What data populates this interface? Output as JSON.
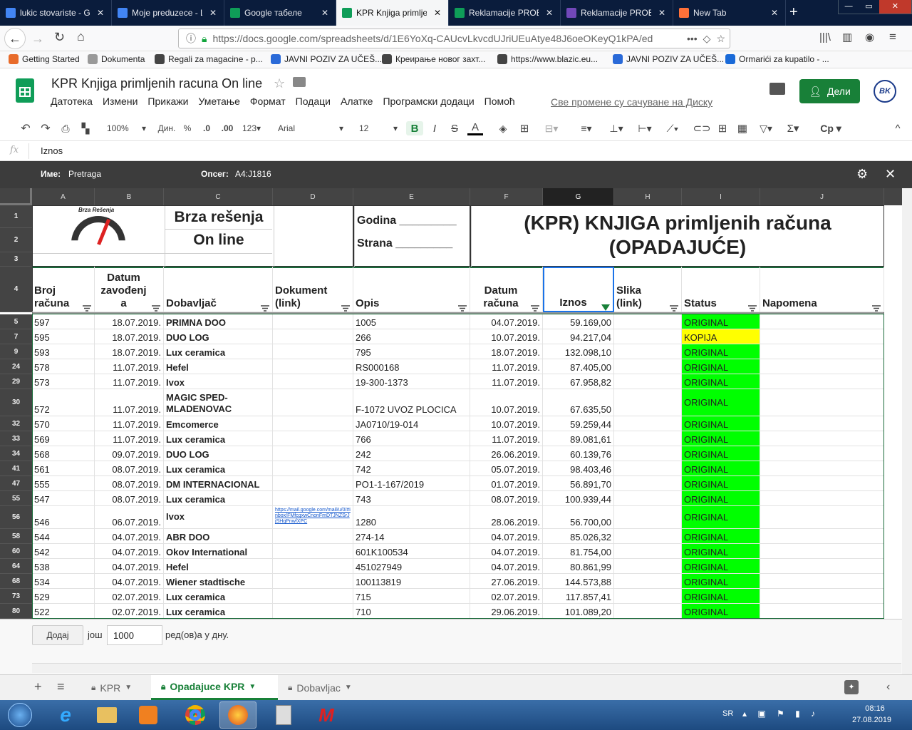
{
  "browser_tabs": [
    {
      "title": "lukic stovariste - G",
      "color": "#4285f4"
    },
    {
      "title": "Moje preduzece - L",
      "color": "#4285f4"
    },
    {
      "title": "Google табеле",
      "color": "#0f9d58"
    },
    {
      "title": "KPR Knjiga primlje",
      "color": "#0f9d58"
    },
    {
      "title": "Reklamacije PROB",
      "color": "#0f9d58"
    },
    {
      "title": "Reklamacije PROB",
      "color": "#7248b9"
    },
    {
      "title": "New Tab",
      "color": "#ff7139"
    }
  ],
  "url": "https://docs.google.com/spreadsheets/d/1E6YoXq-CAUcvLkvcdUJriUEuAtye48J6oeOKeyQ1kPA/ed",
  "bookmarks": [
    "Getting Started",
    "Dokumenta",
    "Regali za magacine - p...",
    "JAVNI POZIV ZA UČEŠ...",
    "Креирање новог захт...",
    "https://www.blazic.eu...",
    "JAVNI POZIV ZA UČEŠ...",
    "Ormarići za kupatilo - ..."
  ],
  "doc_title": "KPR Knjiga primljenih racuna On line",
  "menu": [
    "Датотека",
    "Измени",
    "Прикажи",
    "Уметање",
    "Формат",
    "Подаци",
    "Алатке",
    "Програмски додаци",
    "Помоћ"
  ],
  "save_status": "Све промене су сачуване на Диску",
  "share_label": "Дели",
  "toolbar": {
    "zoom": "100%",
    "currency": "Дин.",
    "percent": "%",
    "dec_less": ".0",
    "dec_more": ".00",
    "format": "123",
    "font": "Arial",
    "size": "12",
    "bold": "B",
    "italic": "I",
    "strike": "S",
    "textcolor": "A"
  },
  "formula": {
    "fx": "fx",
    "value": "Iznos"
  },
  "filter_view": {
    "name_label": "Име:",
    "name": "Pretraga",
    "range_label": "Опсег:",
    "range": "A4:J1816"
  },
  "columns": [
    "A",
    "B",
    "C",
    "D",
    "E",
    "F",
    "G",
    "H",
    "I",
    "J"
  ],
  "header_block": {
    "logo_text": "Brza Rešenja",
    "company_line1": "Brza rešenja",
    "company_line2": "On line",
    "godina": "Godina _________",
    "strana": "Strana _________",
    "title_line1": "(KPR) KNJIGA primljenih računa",
    "title_line2": "(OPADAJUĆE)"
  },
  "table_headers": [
    "Broj računa",
    "Datum zavođenj a",
    "Dobavljač",
    "Dokument (link)",
    "Opis",
    "Datum računa",
    "Iznos",
    "Slika (link)",
    "Status",
    "Napomena"
  ],
  "top_row_numbers": [
    "1",
    "2",
    "3",
    "4"
  ],
  "rows": [
    {
      "n": "5",
      "broj": "597",
      "datum": "18.07.2019.",
      "dob": "PRIMNA DOO",
      "dok": "",
      "opis": "1005",
      "dr": "04.07.2019.",
      "iznos": "59.169,00",
      "status": "ORIGINAL"
    },
    {
      "n": "7",
      "broj": "595",
      "datum": "18.07.2019.",
      "dob": "DUO LOG",
      "dok": "",
      "opis": "266",
      "dr": "10.07.2019.",
      "iznos": "94.217,04",
      "status": "KOPIJA"
    },
    {
      "n": "9",
      "broj": "593",
      "datum": "18.07.2019.",
      "dob": "Lux ceramica",
      "dok": "",
      "opis": "795",
      "dr": "18.07.2019.",
      "iznos": "132.098,10",
      "status": "ORIGINAL"
    },
    {
      "n": "24",
      "broj": "578",
      "datum": "11.07.2019.",
      "dob": "Hefel",
      "dok": "",
      "opis": "RS000168",
      "dr": "11.07.2019.",
      "iznos": "87.405,00",
      "status": "ORIGINAL"
    },
    {
      "n": "29",
      "broj": "573",
      "datum": "11.07.2019.",
      "dob": "Ivox",
      "dok": "",
      "opis": "19-300-1373",
      "dr": "11.07.2019.",
      "iznos": "67.958,82",
      "status": "ORIGINAL"
    },
    {
      "n": "30",
      "broj": "572",
      "datum": "11.07.2019.",
      "dob": "MAGIC SPED-MLADENOVAC",
      "dok": "",
      "opis": "F-1072 UVOZ PLOCICA",
      "dr": "10.07.2019.",
      "iznos": "67.635,50",
      "status": "ORIGINAL"
    },
    {
      "n": "32",
      "broj": "570",
      "datum": "11.07.2019.",
      "dob": "Emcomerce",
      "dok": "",
      "opis": "JA0710/19-014",
      "dr": "10.07.2019.",
      "iznos": "59.259,44",
      "status": "ORIGINAL"
    },
    {
      "n": "33",
      "broj": "569",
      "datum": "11.07.2019.",
      "dob": "Lux ceramica",
      "dok": "",
      "opis": "766",
      "dr": "11.07.2019.",
      "iznos": "89.081,61",
      "status": "ORIGINAL"
    },
    {
      "n": "34",
      "broj": "568",
      "datum": "09.07.2019.",
      "dob": "DUO LOG",
      "dok": "",
      "opis": "242",
      "dr": "26.06.2019.",
      "iznos": "60.139,76",
      "status": "ORIGINAL"
    },
    {
      "n": "41",
      "broj": "561",
      "datum": "08.07.2019.",
      "dob": "Lux ceramica",
      "dok": "",
      "opis": "742",
      "dr": "05.07.2019.",
      "iznos": "98.403,46",
      "status": "ORIGINAL"
    },
    {
      "n": "47",
      "broj": "555",
      "datum": "08.07.2019.",
      "dob": "DM INTERNACIONAL",
      "dok": "",
      "opis": "PO1-1-167/2019",
      "dr": "01.07.2019.",
      "iznos": "56.891,70",
      "status": "ORIGINAL"
    },
    {
      "n": "55",
      "broj": "547",
      "datum": "08.07.2019.",
      "dob": "Lux ceramica",
      "dok": "",
      "opis": "743",
      "dr": "08.07.2019.",
      "iznos": "100.939,44",
      "status": "ORIGINAL"
    },
    {
      "n": "56",
      "broj": "546",
      "datum": "06.07.2019.",
      "dob": "Ivox",
      "dok": "https://mail.google.com/mail/u/0/#inbox/FMfcgxwCnonFmDTJNZSrJjSHqPnwfXPC",
      "opis": "1280",
      "dr": "28.06.2019.",
      "iznos": "56.700,00",
      "status": "ORIGINAL"
    },
    {
      "n": "58",
      "broj": "544",
      "datum": "04.07.2019.",
      "dob": "ABR DOO",
      "dok": "",
      "opis": "274-14",
      "dr": "04.07.2019.",
      "iznos": "85.026,32",
      "status": "ORIGINAL"
    },
    {
      "n": "60",
      "broj": "542",
      "datum": "04.07.2019.",
      "dob": "Okov International",
      "dok": "",
      "opis": "601K100534",
      "dr": "04.07.2019.",
      "iznos": "81.754,00",
      "status": "ORIGINAL"
    },
    {
      "n": "64",
      "broj": "538",
      "datum": "04.07.2019.",
      "dob": "Hefel",
      "dok": "",
      "opis": "451027949",
      "dr": "04.07.2019.",
      "iznos": "80.861,99",
      "status": "ORIGINAL"
    },
    {
      "n": "68",
      "broj": "534",
      "datum": "04.07.2019.",
      "dob": "Wiener stadtische",
      "dok": "",
      "opis": "100113819",
      "dr": "27.06.2019.",
      "iznos": "144.573,88",
      "status": "ORIGINAL"
    },
    {
      "n": "73",
      "broj": "529",
      "datum": "02.07.2019.",
      "dob": "Lux ceramica",
      "dok": "",
      "opis": "715",
      "dr": "02.07.2019.",
      "iznos": "117.857,41",
      "status": "ORIGINAL"
    },
    {
      "n": "80",
      "broj": "522",
      "datum": "02.07.2019.",
      "dob": "Lux ceramica",
      "dok": "",
      "opis": "710",
      "dr": "29.06.2019.",
      "iznos": "101.089,20",
      "status": "ORIGINAL"
    }
  ],
  "add_rows": {
    "button": "Додај",
    "more": "још",
    "count": "1000",
    "suffix": "ред(ов)а у дну."
  },
  "sheet_tabs": [
    "KPR",
    "Opadajuce KPR",
    "Dobavljac"
  ],
  "system": {
    "lang": "SR",
    "time": "08:16",
    "date": "27.08.2019"
  },
  "colors": {
    "green_status": "#00ff00",
    "yellow_status": "#ffff00",
    "sheets_green": "#188038"
  }
}
